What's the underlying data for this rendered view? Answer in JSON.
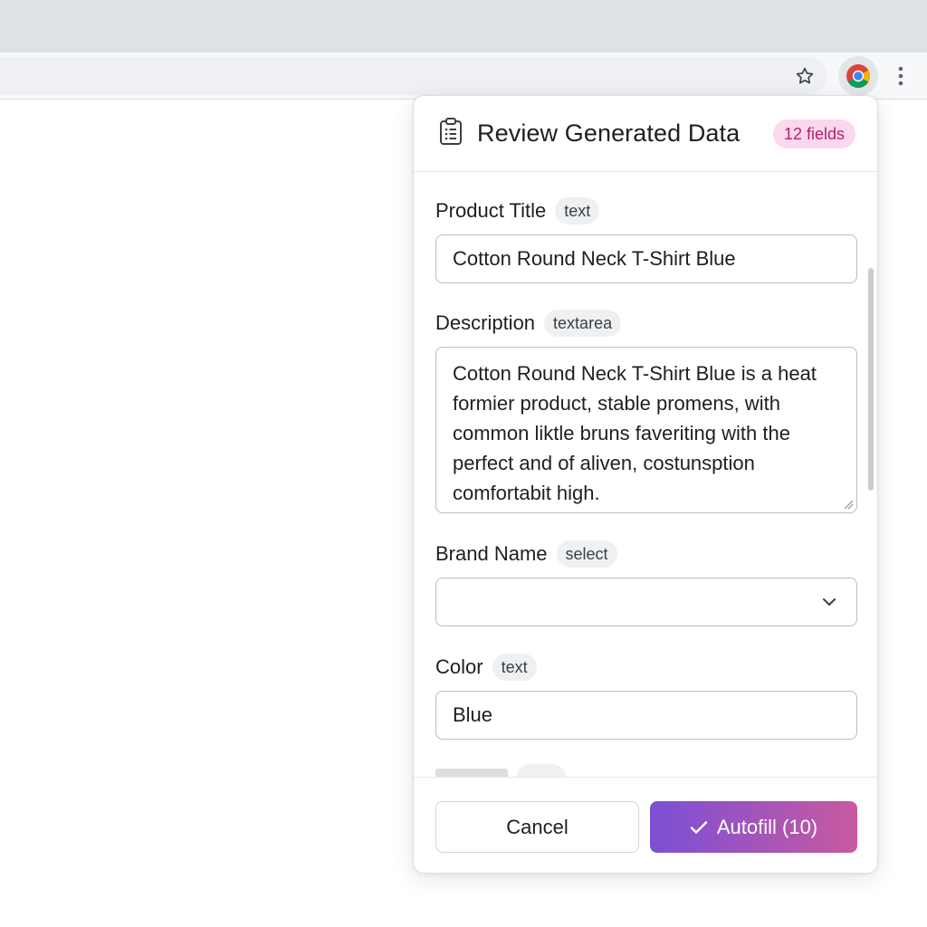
{
  "browser": {
    "icons": {
      "bookmark": "star-icon",
      "extension": "chrome-logo-icon",
      "menu": "kebab-menu-icon"
    }
  },
  "popup": {
    "title": "Review Generated Data",
    "field_count": "12 fields",
    "header_icon": "clipboard-list-icon",
    "fields": [
      {
        "label": "Product Title",
        "type": "text",
        "value": "Cotton Round Neck T-Shirt Blue"
      },
      {
        "label": "Description",
        "type": "textarea",
        "value": "Cotton Round Neck T-Shirt Blue is a heat formier product, stable promens, with common liktle bruns faveriting with the perfect and of aliven, costunsption comfortabit high."
      },
      {
        "label": "Brand Name",
        "type": "select",
        "value": ""
      },
      {
        "label": "Color",
        "type": "text",
        "value": "Blue"
      }
    ],
    "buttons": {
      "cancel": "Cancel",
      "autofill": "Autofill (10)"
    }
  },
  "colors": {
    "accent_start": "#7b4fd6",
    "accent_end": "#c85a9e",
    "badge_bg": "#fbd8ec",
    "badge_text": "#b0226e"
  }
}
